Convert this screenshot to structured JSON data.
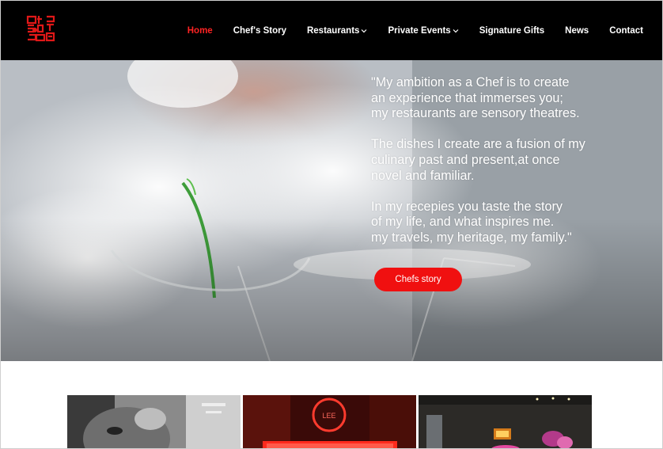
{
  "brand": {
    "logo_text": "LEE",
    "accent_color": "#ff2323"
  },
  "nav": {
    "items": [
      {
        "label": "Home",
        "active": true,
        "has_dropdown": false
      },
      {
        "label": "Chef's Story",
        "active": false,
        "has_dropdown": false
      },
      {
        "label": "Restaurants",
        "active": false,
        "has_dropdown": true
      },
      {
        "label": "Private Events",
        "active": false,
        "has_dropdown": true
      },
      {
        "label": "Signature Gifts",
        "active": false,
        "has_dropdown": false
      },
      {
        "label": "News",
        "active": false,
        "has_dropdown": false
      },
      {
        "label": "Contact",
        "active": false,
        "has_dropdown": false
      }
    ]
  },
  "hero": {
    "quote_paragraphs": [
      "\"My ambition as a Chef is to create\nan experience that immerses you;\nmy restaurants are sensory theatres.",
      "The dishes I create are a fusion of my\nculinary past and present,at once\nnovel and familiar.",
      "In my recepies you taste the story\nof my life, and what inspires me.\nmy travels, my heritage, my family.\""
    ],
    "cta_label": "Chefs story",
    "cta_color": "#f01010"
  },
  "thumbnails": [
    {
      "name": "chef-portrait"
    },
    {
      "name": "restaurant-neon-sign",
      "sign_text": "LEE"
    },
    {
      "name": "dining-room-interior"
    }
  ]
}
